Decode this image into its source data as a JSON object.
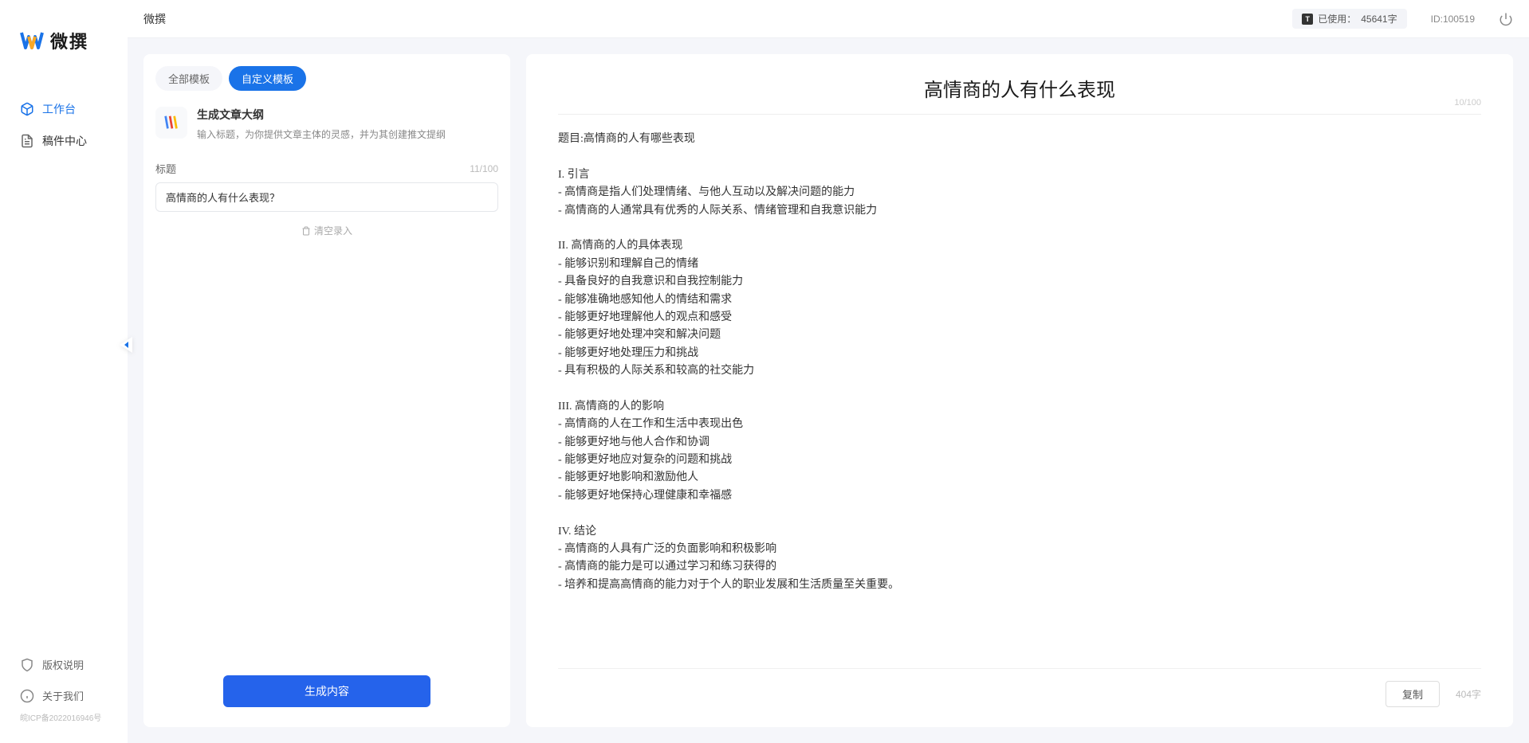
{
  "brand": {
    "name": "微撰"
  },
  "sidebar": {
    "nav": [
      {
        "label": "工作台",
        "active": true
      },
      {
        "label": "稿件中心",
        "active": false
      }
    ],
    "bottom": [
      {
        "label": "版权说明"
      },
      {
        "label": "关于我们"
      }
    ],
    "icp": "皖ICP备2022016946号"
  },
  "header": {
    "title": "微撰",
    "usage_prefix": "已使用：",
    "usage_value": "45641字",
    "user_id": "ID:100519"
  },
  "tabs": [
    {
      "label": "全部模板",
      "active": false
    },
    {
      "label": "自定义模板",
      "active": true
    }
  ],
  "template": {
    "name": "生成文章大纲",
    "desc": "输入标题，为你提供文章主体的灵感，并为其创建推文提纲"
  },
  "form": {
    "title_label": "标题",
    "char_count": "11/100",
    "title_value": "高情商的人有什么表现？",
    "clear_label": "清空录入",
    "generate_label": "生成内容"
  },
  "output": {
    "title": "高情商的人有什么表现",
    "title_count": "10/100",
    "body": "题目:高情商的人有哪些表现\n\nI. 引言\n- 高情商是指人们处理情绪、与他人互动以及解决问题的能力\n- 高情商的人通常具有优秀的人际关系、情绪管理和自我意识能力\n\nII. 高情商的人的具体表现\n- 能够识别和理解自己的情绪\n- 具备良好的自我意识和自我控制能力\n- 能够准确地感知他人的情结和需求\n- 能够更好地理解他人的观点和感受\n- 能够更好地处理冲突和解决问题\n- 能够更好地处理压力和挑战\n- 具有积极的人际关系和较高的社交能力\n\nIII. 高情商的人的影响\n- 高情商的人在工作和生活中表现出色\n- 能够更好地与他人合作和协调\n- 能够更好地应对复杂的问题和挑战\n- 能够更好地影响和激励他人\n- 能够更好地保持心理健康和幸福感\n\nIV. 结论\n- 高情商的人具有广泛的负面影响和积极影响\n- 高情商的能力是可以通过学习和练习获得的\n- 培养和提高高情商的能力对于个人的职业发展和生活质量至关重要。",
    "copy_label": "复制",
    "word_count": "404字"
  }
}
